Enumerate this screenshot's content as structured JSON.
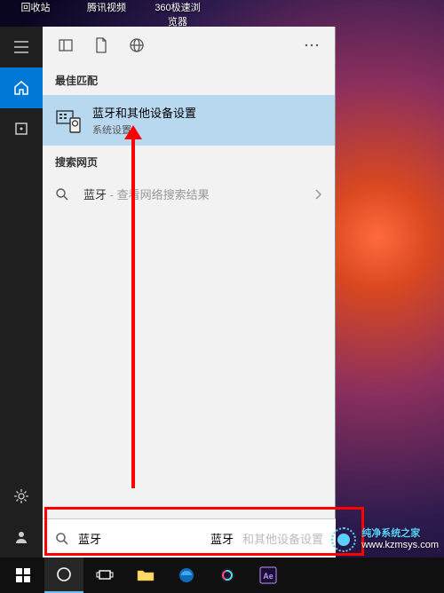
{
  "desktop": {
    "icons": [
      "回收站",
      "腾讯视频",
      "360极速浏览器"
    ]
  },
  "rail": {
    "items": [
      {
        "name": "menu",
        "active": false
      },
      {
        "name": "home",
        "active": true
      },
      {
        "name": "device",
        "active": false
      }
    ],
    "bottom": [
      {
        "name": "settings"
      },
      {
        "name": "account"
      }
    ]
  },
  "panel": {
    "header_icons": [
      "panel-icon",
      "document-icon",
      "globe-icon",
      "more-icon"
    ],
    "best_match_label": "最佳匹配",
    "best_match": {
      "highlight": "蓝牙",
      "rest": "和其他设备设置",
      "subtitle": "系统设置"
    },
    "web_label": "搜索网页",
    "web_result": {
      "highlight": "蓝牙",
      "suffix": " - 查看网络搜索结果"
    }
  },
  "search": {
    "query": "蓝牙",
    "placeholder": "和其他设备设置"
  },
  "taskbar": {
    "items": [
      "start",
      "cortana",
      "taskview",
      "folder",
      "edge",
      "browser",
      "ae"
    ]
  },
  "watermark": {
    "brand": "纯净系统之家",
    "url": "www.kzmsys.com"
  }
}
